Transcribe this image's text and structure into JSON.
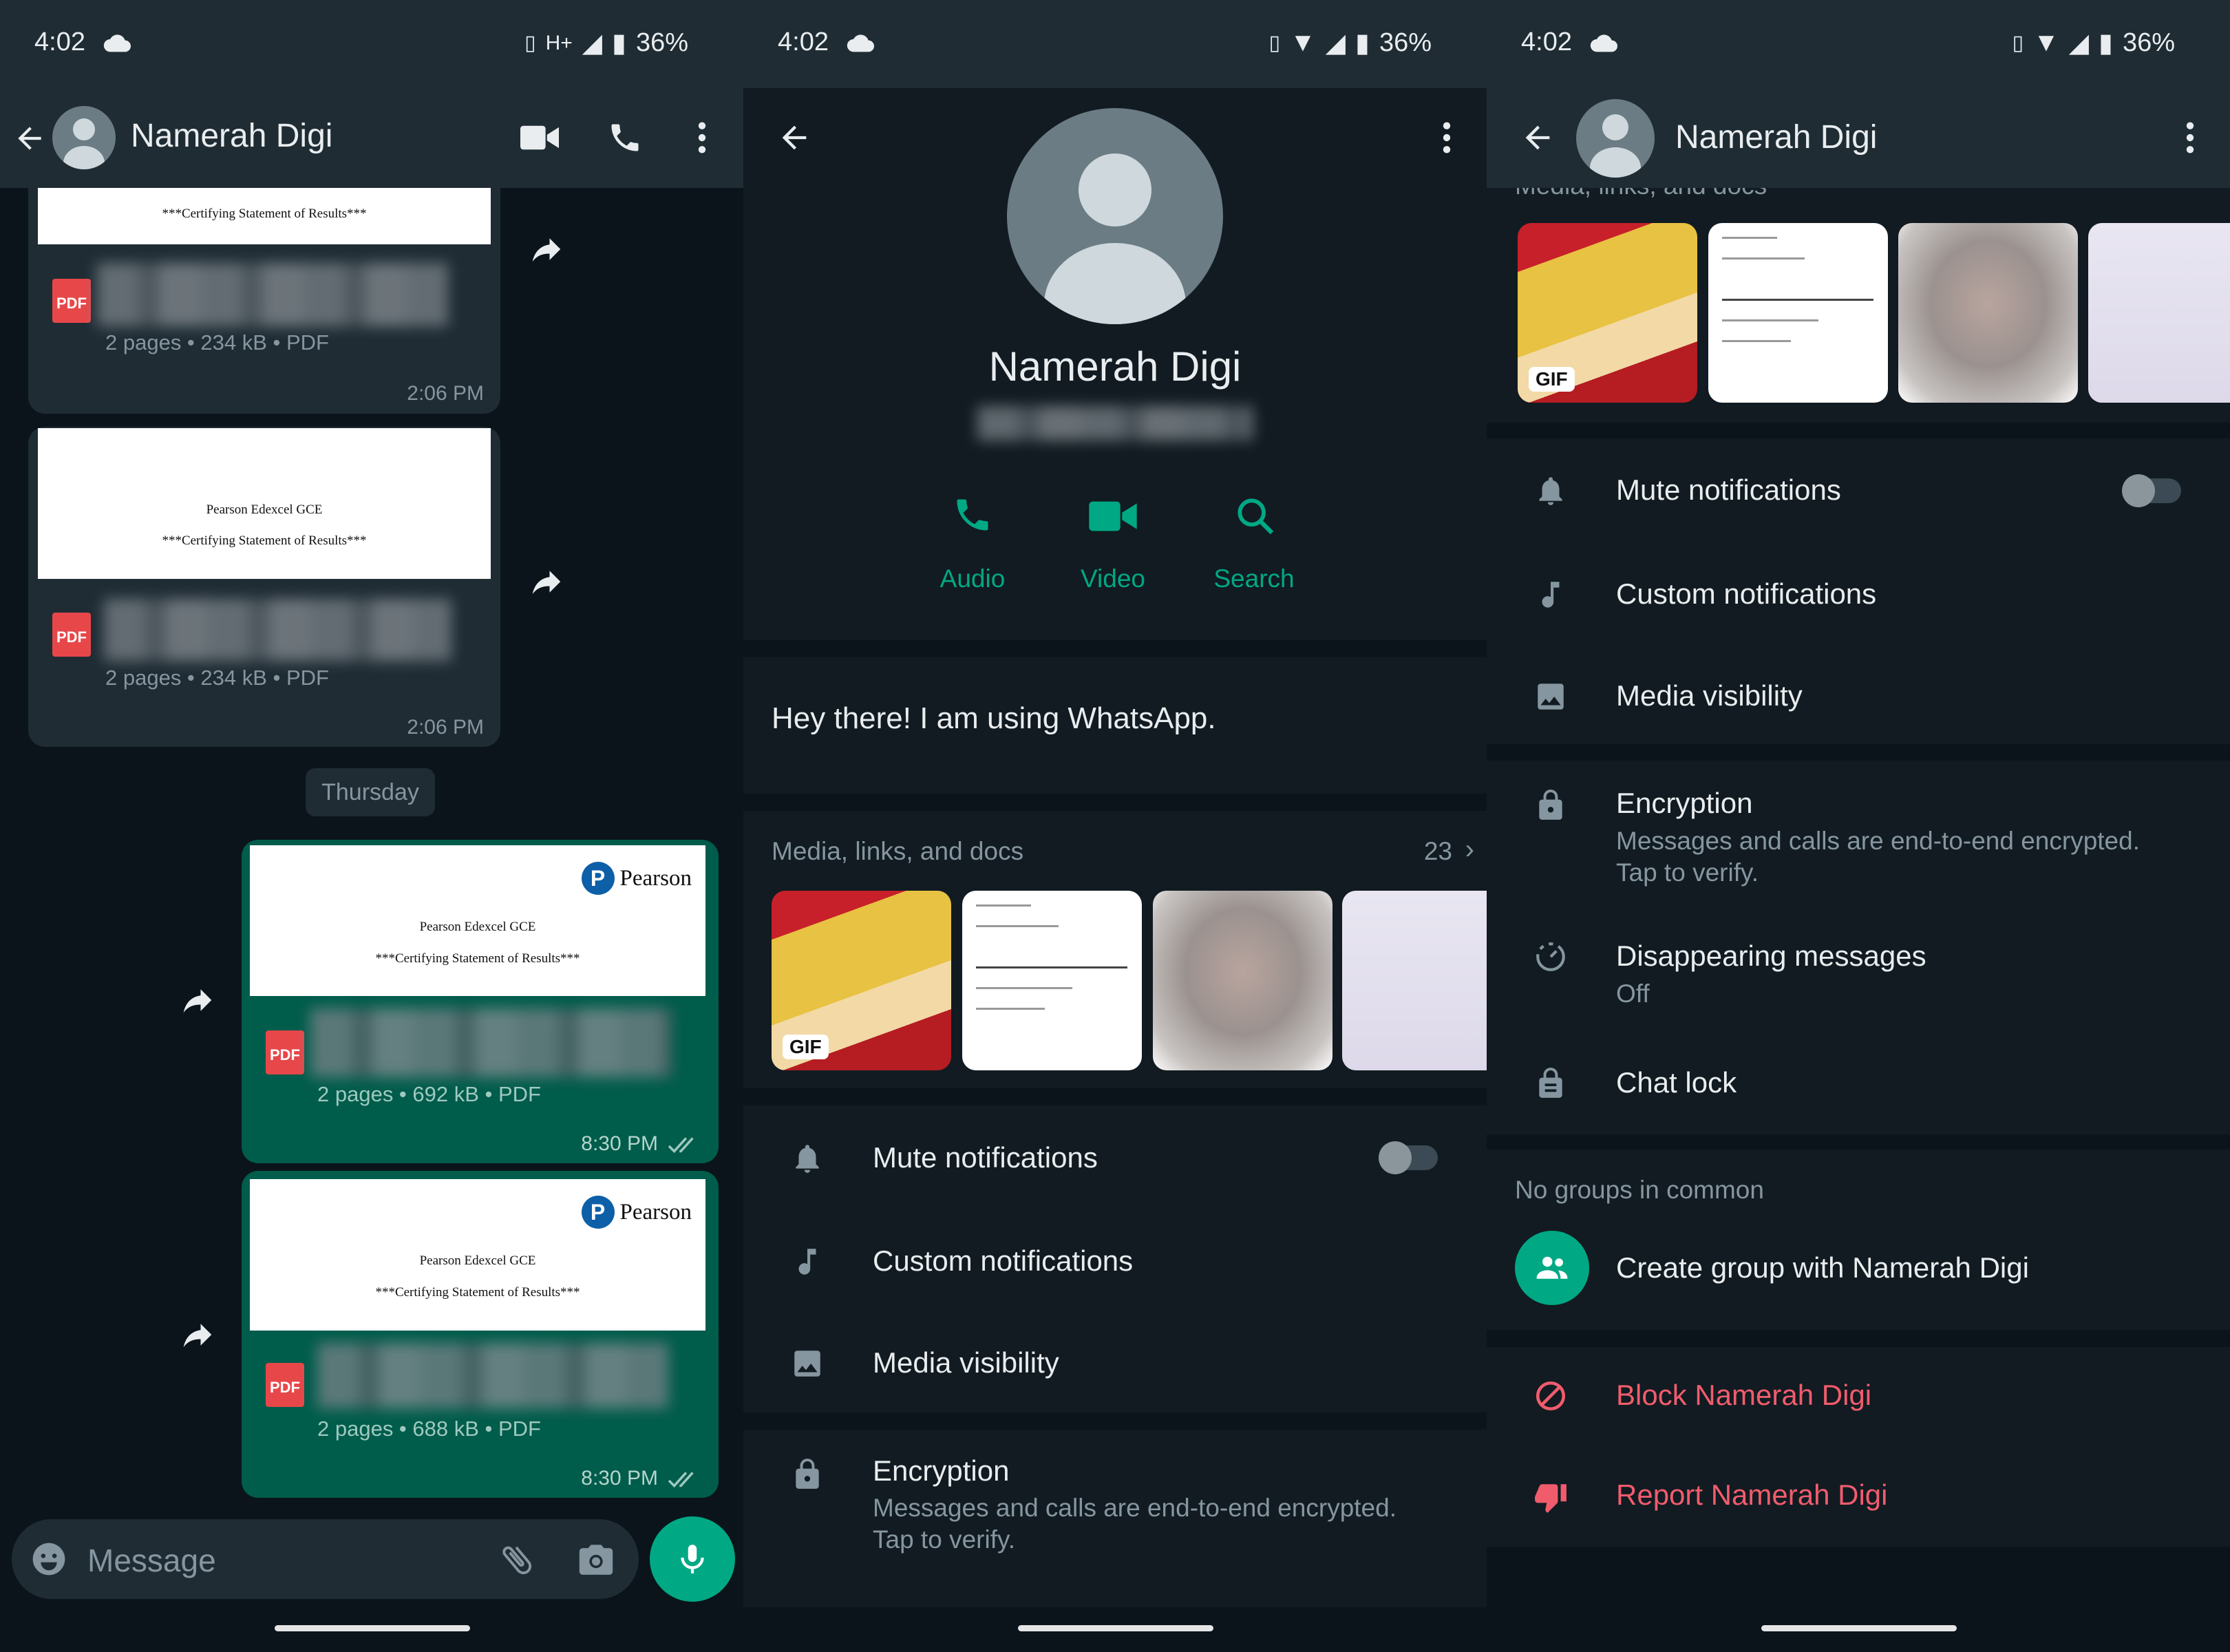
{
  "chat": {
    "status": {
      "time": "4:02",
      "network": "H+",
      "battery": "36%"
    },
    "header": {
      "contact_name": "Namerah Digi"
    },
    "messages": [
      {
        "direction": "incoming",
        "preview_title": "",
        "preview_subtitle": "***Certifying Statement of Results***",
        "file_icon": "PDF",
        "meta": "2 pages • 234 kB • PDF",
        "time": "2:06 PM"
      },
      {
        "direction": "incoming",
        "preview_title": "Pearson Edexcel GCE",
        "preview_subtitle": "***Certifying Statement of Results***",
        "file_icon": "PDF",
        "meta": "2 pages • 234 kB • PDF",
        "time": "2:06 PM"
      },
      {
        "direction": "outgoing",
        "logo_text": "Pearson",
        "preview_title": "Pearson Edexcel GCE",
        "preview_subtitle": "***Certifying Statement of Results***",
        "file_icon": "PDF",
        "meta": "2 pages • 692 kB • PDF",
        "time": "8:30 PM",
        "read": true
      },
      {
        "direction": "outgoing",
        "logo_text": "Pearson",
        "preview_title": "Pearson Edexcel GCE",
        "preview_subtitle": "***Certifying Statement of Results***",
        "file_icon": "PDF",
        "meta": "2 pages • 688 kB • PDF",
        "time": "8:30 PM",
        "read": true
      }
    ],
    "date_chip": "Thursday",
    "composer": {
      "placeholder": "Message"
    }
  },
  "contact_info": {
    "status": {
      "time": "4:02",
      "battery": "36%"
    },
    "name": "Namerah Digi",
    "actions": [
      {
        "label": "Audio",
        "icon": "phone-icon"
      },
      {
        "label": "Video",
        "icon": "video-icon"
      },
      {
        "label": "Search",
        "icon": "search-icon"
      }
    ],
    "about": "Hey there! I am using WhatsApp.",
    "media": {
      "title": "Media, links, and docs",
      "count": "23",
      "gif_badge": "GIF"
    },
    "settings": [
      {
        "label": "Mute notifications",
        "toggle_on": false
      },
      {
        "label": "Custom notifications"
      },
      {
        "label": "Media visibility"
      }
    ],
    "encryption": {
      "title": "Encryption",
      "subtitle": "Messages and calls are end-to-end encrypted. Tap to verify."
    }
  },
  "contact_info_scrolled": {
    "status": {
      "time": "4:02",
      "battery": "36%"
    },
    "header": {
      "contact_name": "Namerah Digi"
    },
    "media": {
      "title": "Media, links, and docs",
      "gif_badge": "GIF"
    },
    "settings": [
      {
        "label": "Mute notifications",
        "toggle_on": false
      },
      {
        "label": "Custom notifications"
      },
      {
        "label": "Media visibility"
      }
    ],
    "encryption": {
      "title": "Encryption",
      "subtitle": "Messages and calls are end-to-end encrypted. Tap to verify."
    },
    "disappearing": {
      "title": "Disappearing messages",
      "value": "Off"
    },
    "chat_lock": "Chat lock",
    "groups_header": "No groups in common",
    "create_group": "Create group with Namerah Digi",
    "block": "Block Namerah Digi",
    "report": "Report Namerah Digi"
  },
  "colors": {
    "accent": "#00a884",
    "outgoing_bubble": "#005c4b",
    "incoming_bubble": "#1f2c34",
    "danger": "#f15c6d",
    "background": "#0b141a"
  }
}
